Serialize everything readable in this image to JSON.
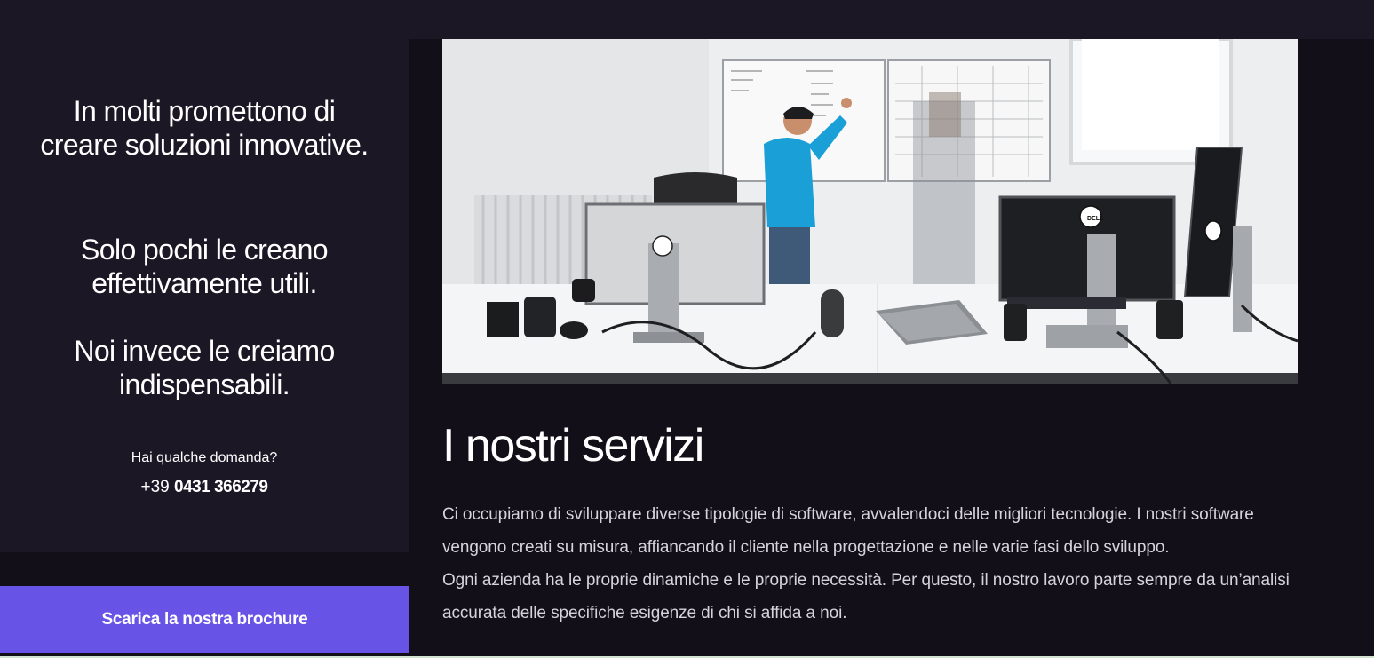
{
  "sidebar": {
    "tagline_1": "In molti promettono di creare soluzioni innovative.",
    "tagline_2": "Solo pochi le creano effettivamente utili.",
    "tagline_3": "Noi invece le creiamo indispensabili.",
    "question": "Hai qualche domanda?",
    "phone_prefix": "+39",
    "phone_number": "0431 366279",
    "brochure_button": "Scarica la nostra brochure"
  },
  "main": {
    "section_title": "I nostri servizi",
    "paragraph_1": "Ci occupiamo di sviluppare diverse tipologie di software, avvalendoci delle migliori tecnologie. I nostri software vengono creati su misura, affiancando il cliente nella progettazione e nelle varie fasi dello sviluppo.",
    "paragraph_2": "Ogni azienda ha le proprie dinamiche e le proprie necessità. Per questo, il nostro lavoro parte sempre da un’analisi accurata delle specifiche esigenze di chi si affida a noi."
  },
  "hero_image": {
    "brand_label": "DELL"
  },
  "colors": {
    "page_background": "#120f18",
    "panel_background": "#1c1725",
    "accent": "#6753e6",
    "body_text": "#d6d3dc"
  }
}
